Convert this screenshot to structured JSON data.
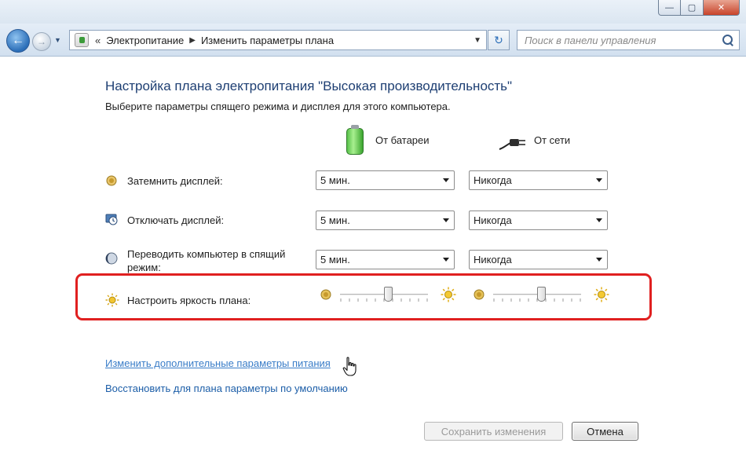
{
  "window": {
    "min_glyph": "—",
    "max_glyph": "▢",
    "close_glyph": "✕"
  },
  "nav": {
    "back_glyph": "←",
    "forward_glyph": "→",
    "history_glyph": "▼",
    "breadcrumb_prefix": "«",
    "breadcrumbs": [
      "Электропитание",
      "Изменить параметры плана"
    ],
    "crumb_separator": "▶",
    "address_dropdown_glyph": "▼",
    "refresh_glyph": "↻",
    "search_placeholder": "Поиск в панели управления"
  },
  "page": {
    "title": "Настройка плана электропитания \"Высокая производительность\"",
    "subtitle": "Выберите параметры спящего режима и дисплея для этого компьютера."
  },
  "columns": {
    "battery": "От батареи",
    "plugged": "От сети"
  },
  "settings": [
    {
      "id": "dim",
      "icon": "dim-display-icon",
      "label": "Затемнить дисплей:",
      "battery": "5 мин.",
      "plugged": "Никогда"
    },
    {
      "id": "off",
      "icon": "turn-off-display-icon",
      "label": "Отключать дисплей:",
      "battery": "5 мин.",
      "plugged": "Никогда"
    },
    {
      "id": "sleep",
      "icon": "sleep-icon",
      "label": "Переводить компьютер в спящий режим:",
      "battery": "5 мин.",
      "plugged": "Никогда"
    }
  ],
  "brightness": {
    "label": "Настроить яркость плана:",
    "battery_level": 0.55,
    "plugged_level": 0.55
  },
  "links": {
    "advanced": "Изменить дополнительные параметры питания",
    "restore": "Восстановить для плана параметры по умолчанию"
  },
  "buttons": {
    "save": "Сохранить изменения",
    "cancel": "Отмена"
  },
  "colors": {
    "highlight": "#e02020",
    "title": "#1e3f73",
    "link": "#1c5ea8"
  }
}
